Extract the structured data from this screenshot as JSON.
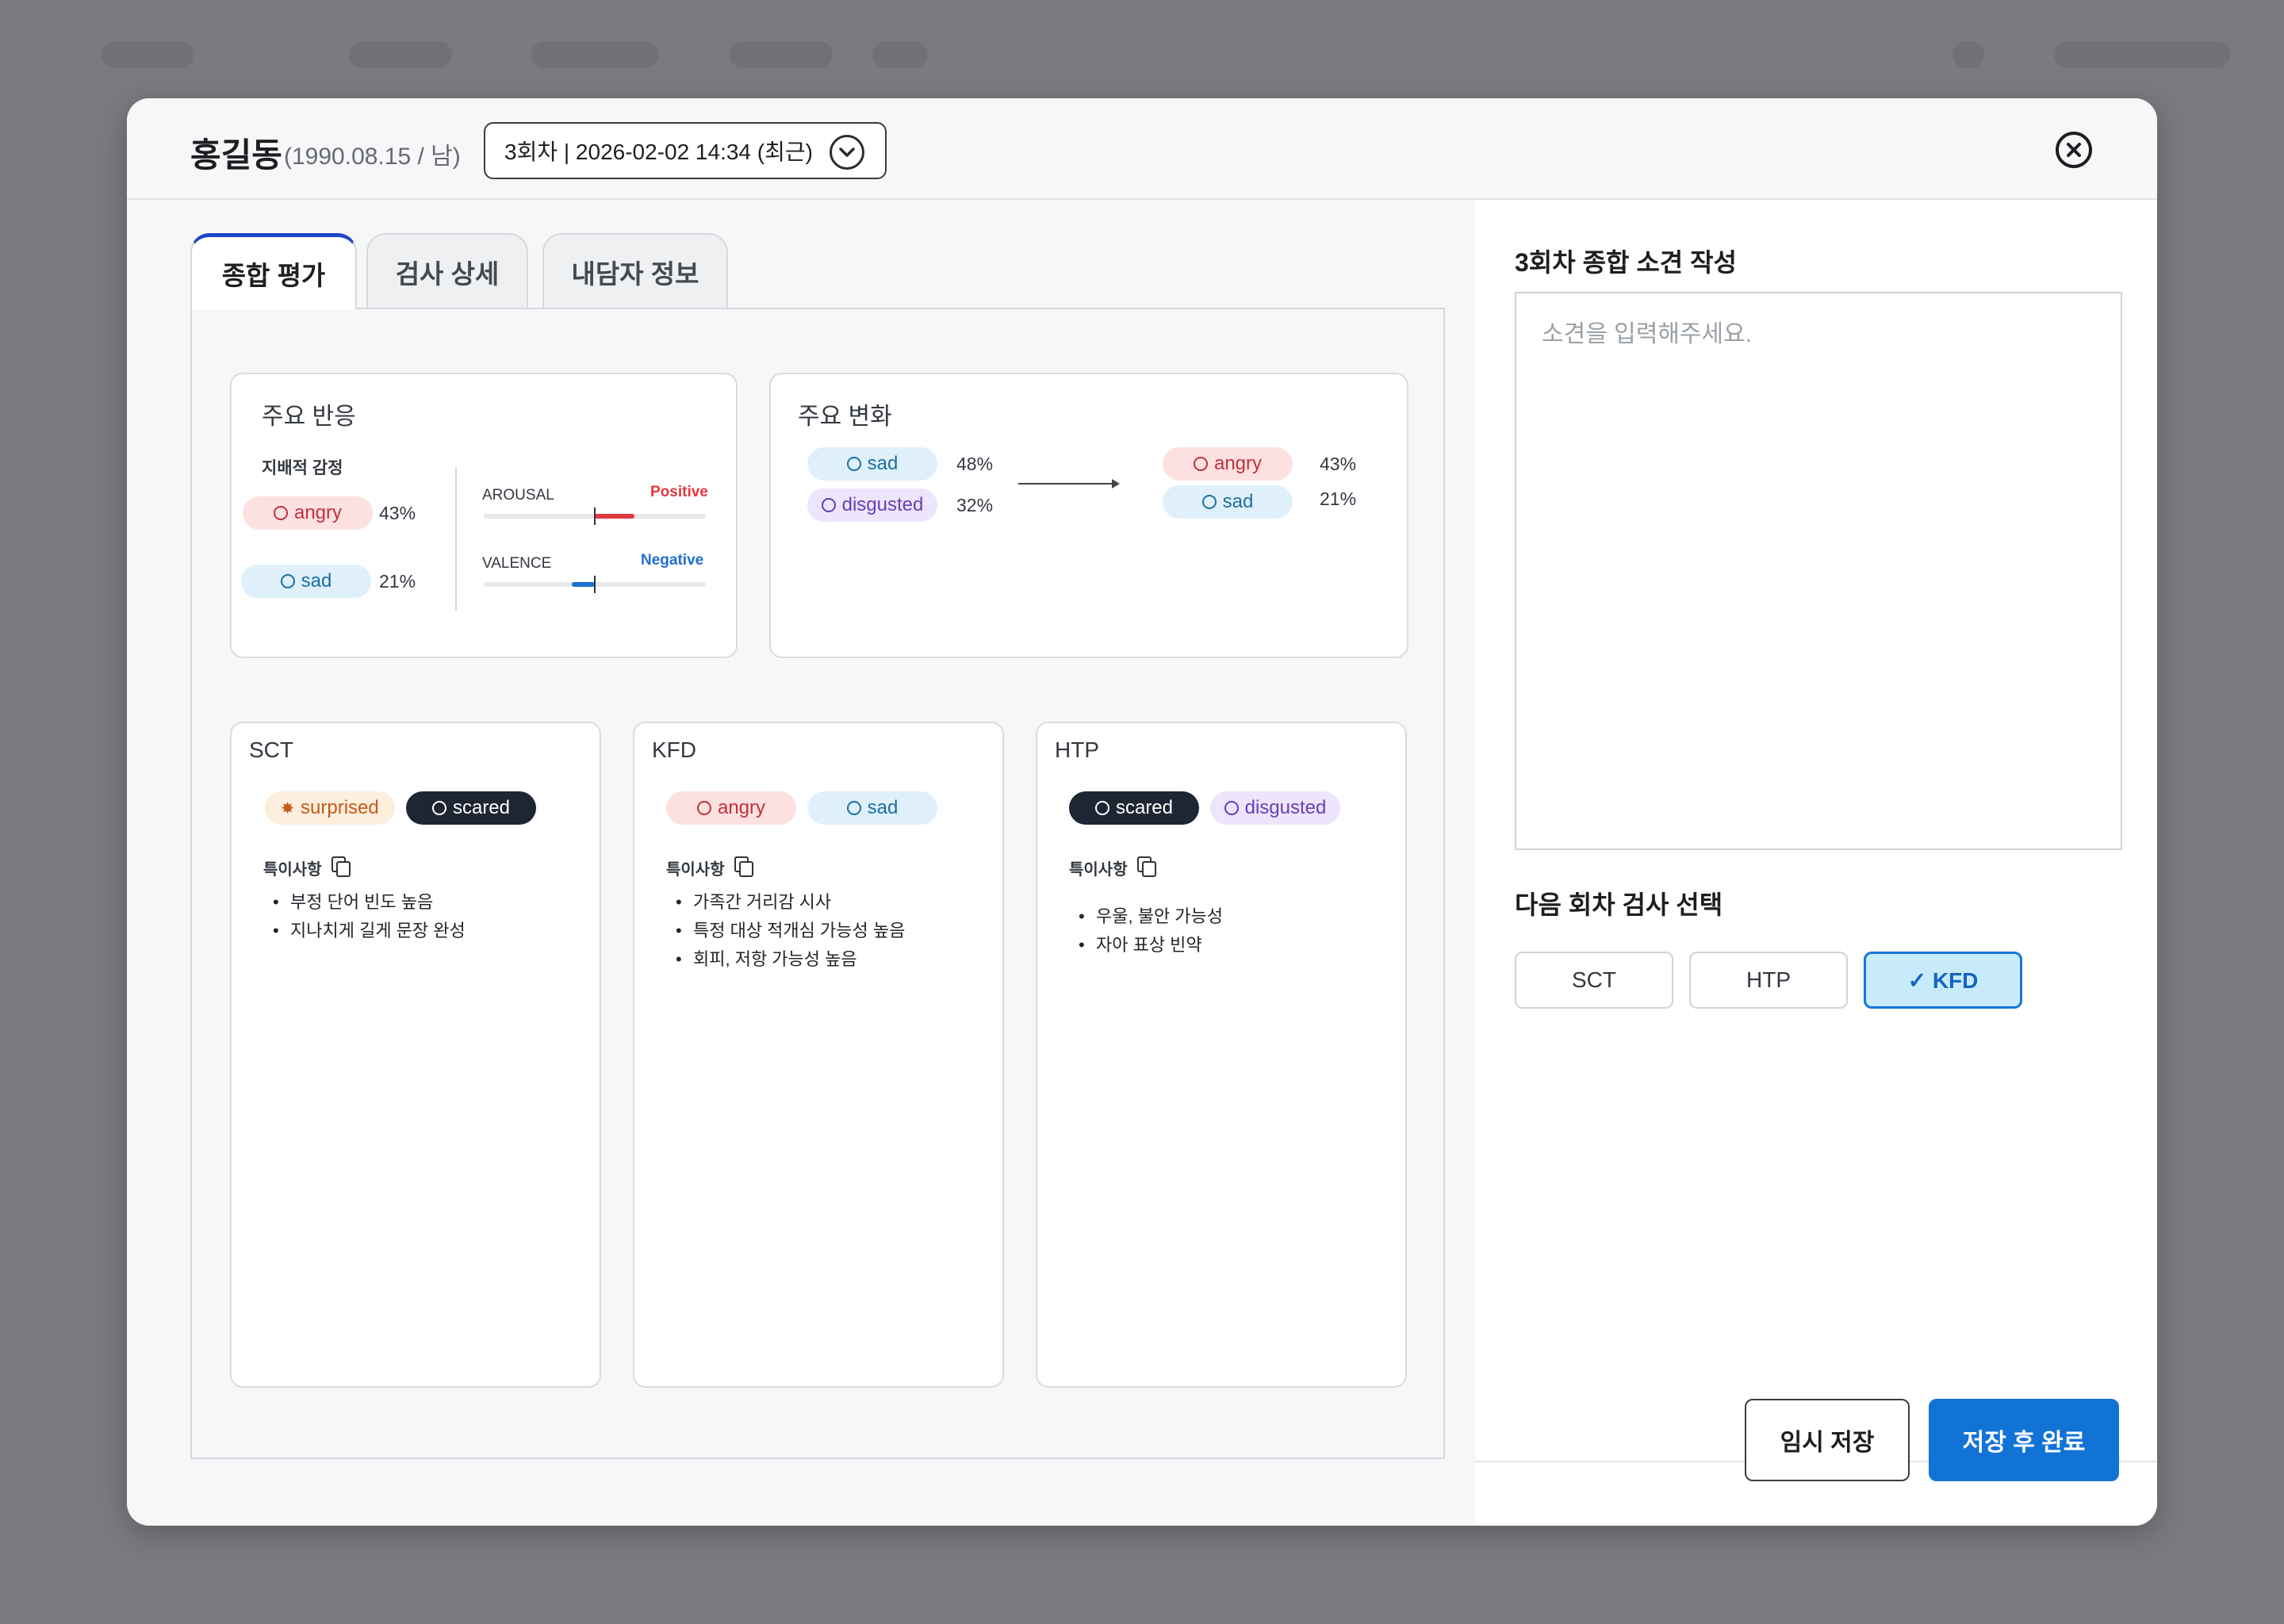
{
  "modal": {
    "patient_name": "홍길동",
    "patient_meta": "(1990.08.15 / 남)",
    "session_selected": "3회차 | 2026-02-02 14:34 (최근)"
  },
  "tabs": [
    {
      "label": "종합 평가",
      "active": true
    },
    {
      "label": "검사 상세",
      "active": false
    },
    {
      "label": "내담자 정보",
      "active": false
    }
  ],
  "main_response": {
    "title": "주요 반응",
    "dominant_label": "지배적 감정",
    "emotions": [
      {
        "name": "angry",
        "pct": "43%"
      },
      {
        "name": "sad",
        "pct": "21%"
      }
    ],
    "arousal": {
      "label": "AROUSAL",
      "tag": "Positive",
      "value": 0.36
    },
    "valence": {
      "label": "VALENCE",
      "tag": "Negative",
      "value": -0.21
    }
  },
  "main_change": {
    "title": "주요 변화",
    "before": [
      {
        "name": "sad",
        "pct": "48%"
      },
      {
        "name": "disgusted",
        "pct": "32%"
      }
    ],
    "after": [
      {
        "name": "angry",
        "pct": "43%"
      },
      {
        "name": "sad",
        "pct": "21%"
      }
    ]
  },
  "tests": [
    {
      "name": "SCT",
      "tags": [
        "surprised",
        "scared"
      ],
      "notes_label": "특이사항",
      "notes": [
        "부정 단어 빈도 높음",
        "지나치게 길게 문장 완성"
      ]
    },
    {
      "name": "KFD",
      "tags": [
        "angry",
        "sad"
      ],
      "notes_label": "특이사항",
      "notes": [
        "가족간 거리감 시사",
        "특정 대상 적개심 가능성 높음",
        "회피, 저항 가능성 높음"
      ]
    },
    {
      "name": "HTP",
      "tags": [
        "scared",
        "disgusted"
      ],
      "notes_label": "특이사항",
      "notes": [
        "우울, 불안 가능성",
        "자아 표상 빈약"
      ]
    }
  ],
  "right": {
    "opinion_title": "3회차 종합 소견 작성",
    "opinion_placeholder": "소견을 입력해주세요.",
    "next_test_title": "다음 회차 검사 선택",
    "next_tests": [
      {
        "label": "SCT",
        "selected": false
      },
      {
        "label": "HTP",
        "selected": false
      },
      {
        "label": "✓ KFD",
        "selected": true
      }
    ],
    "temp_save": "임시 저장",
    "save_done": "저장 후 완료"
  },
  "colors": {
    "accent": "#1273d6",
    "tab_active_border": "#1e46c8",
    "positive": "#e0383e",
    "negative": "#1e6fd0"
  },
  "icons": {
    "angry": "angry-face-icon",
    "sad": "sad-face-icon",
    "disgusted": "prohibit-icon",
    "surprised": "burst-icon",
    "scared": "shield-face-icon",
    "copy": "copy-icon",
    "close": "close-icon",
    "dropdown": "chevron-down-icon"
  }
}
